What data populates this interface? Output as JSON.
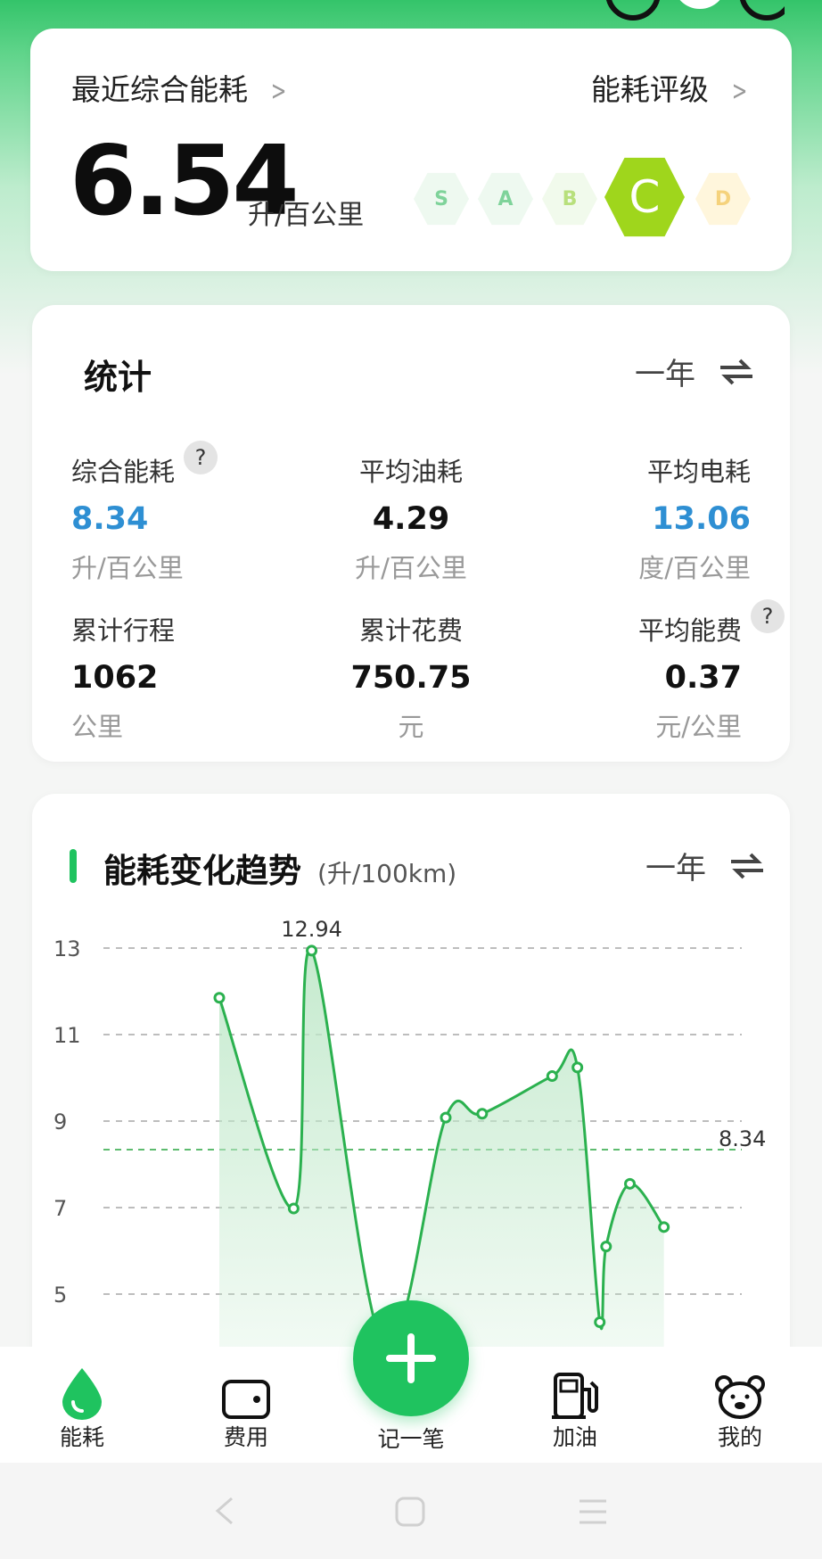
{
  "consumption": {
    "recent_label": "最近综合能耗",
    "rating_label": "能耗评级",
    "value": "6.54",
    "unit": "升/百公里",
    "grades": [
      "S",
      "A",
      "B",
      "C",
      "D"
    ],
    "active_grade": "C"
  },
  "stats": {
    "title": "统计",
    "period": "一年",
    "items": [
      {
        "label": "综合能耗",
        "value": "8.34",
        "unit": "升/百公里",
        "help": "?"
      },
      {
        "label": "平均油耗",
        "value": "4.29",
        "unit": "升/百公里"
      },
      {
        "label": "平均电耗",
        "value": "13.06",
        "unit": "度/百公里"
      },
      {
        "label": "累计行程",
        "value": "1062",
        "unit": "公里"
      },
      {
        "label": "累计花费",
        "value": "750.75",
        "unit": "元"
      },
      {
        "label": "平均能费",
        "value": "0.37",
        "unit": "元/公里",
        "help": "?"
      }
    ]
  },
  "trend": {
    "title": "能耗变化趋势",
    "unit": "(升/100km)",
    "period": "一年"
  },
  "chart_data": {
    "type": "area",
    "title": "能耗变化趋势",
    "ylabel": "(升/100km)",
    "y_ticks": [
      13,
      11,
      9,
      7,
      5
    ],
    "ylim": [
      3.5,
      13.5
    ],
    "points": [
      11.85,
      6.98,
      12.94,
      3.8,
      9.08,
      9.17,
      10.04,
      10.24,
      4.35,
      6.1,
      7.55,
      6.55
    ],
    "point_x": [
      0,
      1.53,
      1.9,
      3.38,
      4.66,
      5.41,
      6.85,
      7.37,
      7.83,
      7.96,
      8.45,
      9.15
    ],
    "max_label": "12.94",
    "reference_line": {
      "value": 8.34,
      "label": "8.34"
    },
    "grid": true,
    "colors": {
      "line": "#2bb14f",
      "fill": "#bfe8c9",
      "reference": "#5dbb6f"
    }
  },
  "tabs": [
    {
      "id": "energy",
      "label": "能耗"
    },
    {
      "id": "cost",
      "label": "费用"
    },
    {
      "id": "record",
      "label": "记一笔"
    },
    {
      "id": "fuel",
      "label": "加油"
    },
    {
      "id": "mine",
      "label": "我的"
    }
  ],
  "colors": {
    "accent": "#1fc35f",
    "blue": "#2e8fd3",
    "grade_active": "#9fd61c"
  }
}
